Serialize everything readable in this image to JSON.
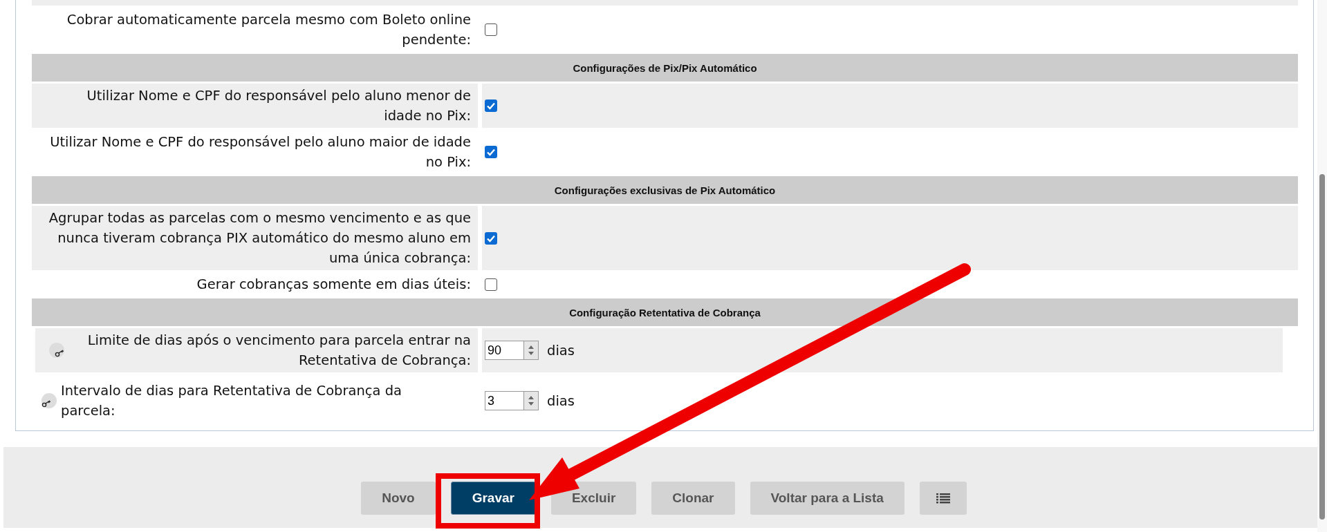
{
  "form": {
    "rows": [
      {
        "kind": "checkbox",
        "label": "Cobrar automaticamente parcela mesmo com Boleto online pendente:",
        "checked": false
      },
      {
        "kind": "header",
        "label": "Configurações de Pix/Pix Automático"
      },
      {
        "kind": "checkbox",
        "label": "Utilizar Nome e CPF do responsável pelo aluno menor de idade no Pix:",
        "checked": true
      },
      {
        "kind": "checkbox",
        "label": "Utilizar Nome e CPF do responsável pelo aluno maior de idade no Pix:",
        "checked": true
      },
      {
        "kind": "header",
        "label": "Configurações exclusivas de Pix Automático"
      },
      {
        "kind": "checkbox",
        "label": "Agrupar todas as parcelas com o mesmo vencimento e as que nunca tiveram cobrança PIX automático do mesmo aluno em uma única cobrança:",
        "checked": true
      },
      {
        "kind": "checkbox",
        "label": "Gerar cobranças somente em dias úteis:",
        "checked": false
      },
      {
        "kind": "header",
        "label": "Configuração Retentativa de Cobrança"
      },
      {
        "kind": "number",
        "label": "Limite de dias após o vencimento para parcela entrar na Retentativa de Cobrança:",
        "value": "90",
        "unit": "dias"
      },
      {
        "kind": "number-wide",
        "label": "Intervalo de dias para Retentativa de Cobrança da parcela:",
        "value": "3",
        "unit": "dias"
      }
    ]
  },
  "buttons": [
    {
      "kind": "text",
      "label": "Novo",
      "primary": false
    },
    {
      "kind": "text",
      "label": "Gravar",
      "primary": true
    },
    {
      "kind": "text",
      "label": "Excluir",
      "primary": false
    },
    {
      "kind": "text",
      "label": "Clonar",
      "primary": false
    },
    {
      "kind": "text",
      "label": "Voltar para a Lista",
      "primary": false
    },
    {
      "kind": "icon"
    }
  ]
}
